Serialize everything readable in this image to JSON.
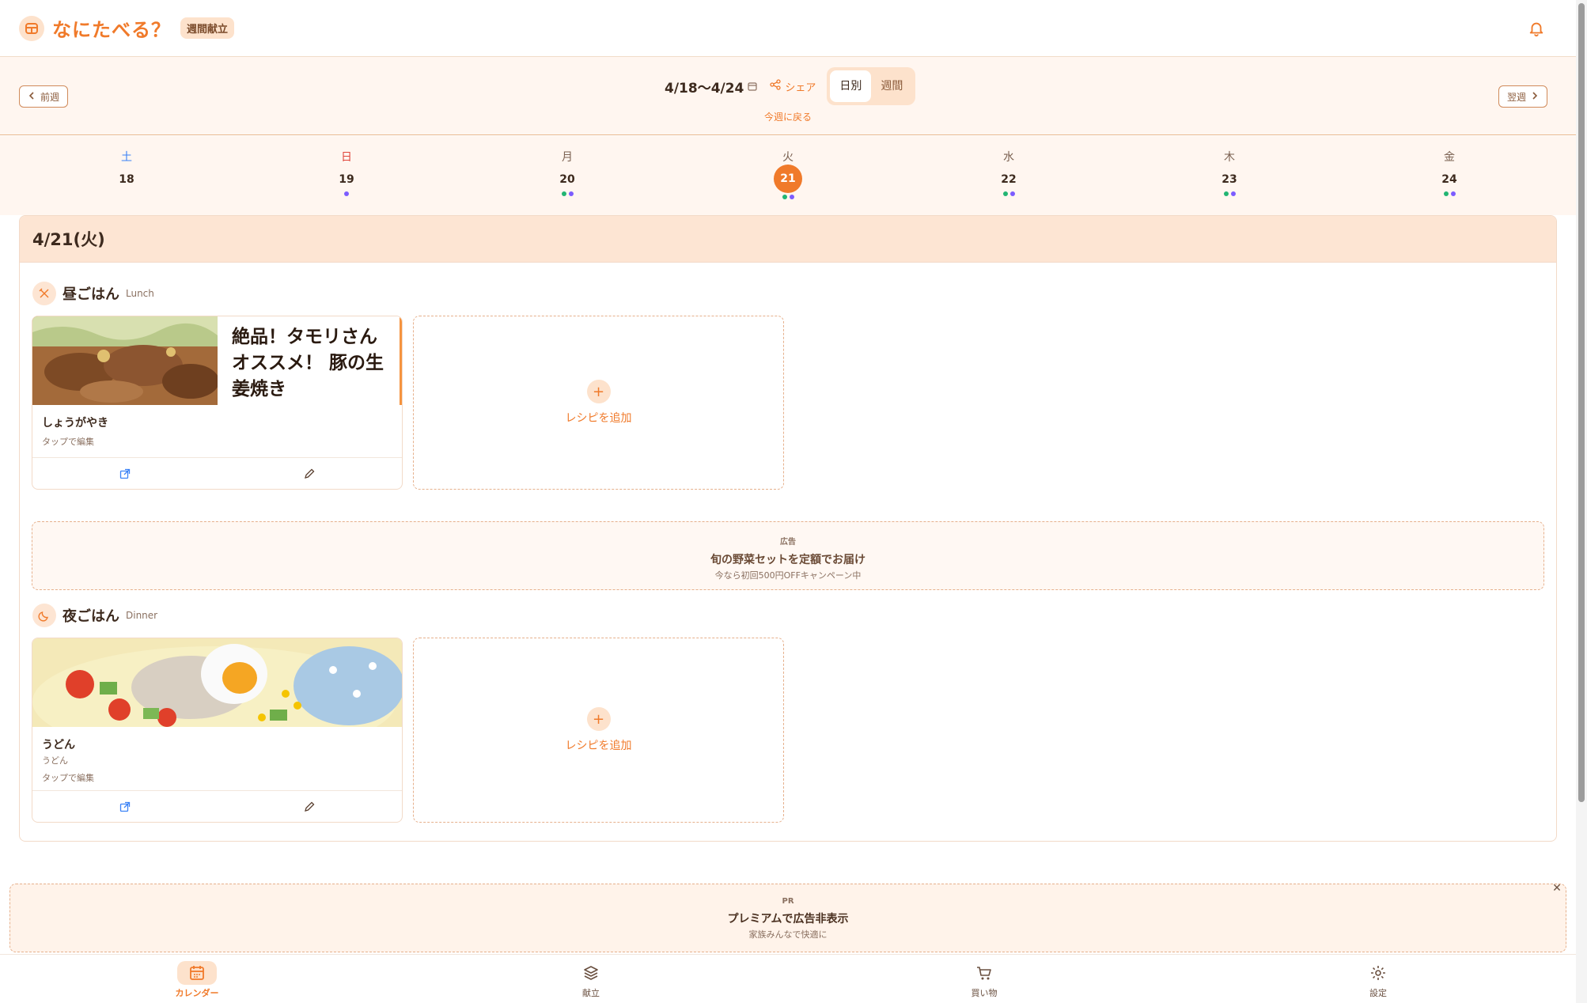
{
  "header": {
    "app_title": "なにたべる？",
    "badge": "週間献立"
  },
  "week_nav": {
    "prev_label": "前週",
    "next_label": "翌週",
    "range": "4/18〜4/24",
    "share_label": "シェア",
    "view_daily": "日別",
    "view_weekly": "週間",
    "back_to_this_week": "今週に戻る"
  },
  "days": [
    {
      "dow": "土",
      "date": "18",
      "dow_color": "#3b82f6",
      "dots": []
    },
    {
      "dow": "日",
      "date": "19",
      "dow_color": "#e0453a",
      "dots": [
        "#7c5cff"
      ]
    },
    {
      "dow": "月",
      "date": "20",
      "dow_color": "#7a6050",
      "dots": [
        "#22b573",
        "#7c5cff"
      ]
    },
    {
      "dow": "火",
      "date": "21",
      "dow_color": "#7a6050",
      "dots": [
        "#22b573",
        "#7c5cff"
      ],
      "selected": true
    },
    {
      "dow": "水",
      "date": "22",
      "dow_color": "#7a6050",
      "dots": [
        "#22b573",
        "#7c5cff"
      ]
    },
    {
      "dow": "木",
      "date": "23",
      "dow_color": "#7a6050",
      "dots": [
        "#22b573",
        "#7c5cff"
      ]
    },
    {
      "dow": "金",
      "date": "24",
      "dow_color": "#7a6050",
      "dots": [
        "#22b573",
        "#7c5cff"
      ]
    }
  ],
  "day_panel": {
    "title": "4/21(火)",
    "lunch": {
      "title": "昼ごはん",
      "subtitle": "Lunch",
      "recipe": {
        "image_title": "絶品！タモリさんオススメ！ 豚の生姜焼き",
        "name": "しょうがやき",
        "hint": "タップで編集"
      },
      "add_label": "レシピを追加"
    },
    "ad": {
      "tag": "広告",
      "title": "旬の野菜セットを定額でお届け",
      "sub": "今なら初回500円OFFキャンペーン中"
    },
    "dinner": {
      "title": "夜ごはん",
      "subtitle": "Dinner",
      "recipe": {
        "name": "うどん",
        "sub": "うどん",
        "hint": "タップで編集"
      },
      "add_label": "レシピを追加"
    }
  },
  "premium_banner": {
    "tag": "PR",
    "title": "プレミアムで広告非表示",
    "sub": "家族みんなで快適に"
  },
  "bottom_nav": [
    {
      "label": "カレンダー",
      "icon": "calendar-icon",
      "active": true
    },
    {
      "label": "献立",
      "icon": "layers-icon",
      "active": false
    },
    {
      "label": "買い物",
      "icon": "cart-icon",
      "active": false
    },
    {
      "label": "設定",
      "icon": "gear-icon",
      "active": false
    }
  ],
  "colors": {
    "accent": "#f07a2a",
    "accent_light": "#fde2cc",
    "text": "#3d2a1e"
  }
}
